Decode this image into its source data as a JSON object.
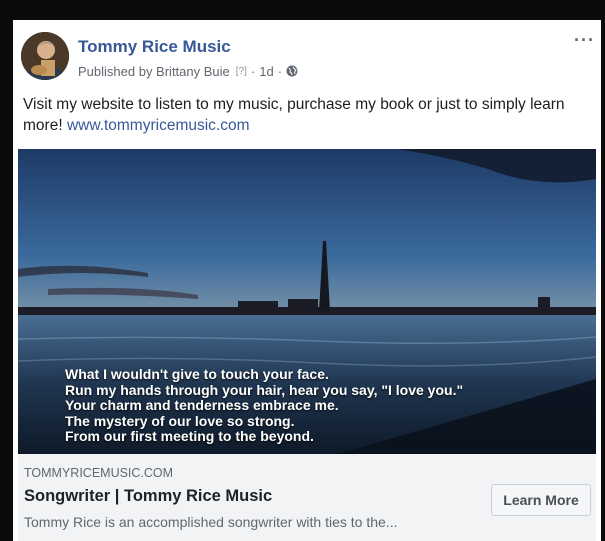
{
  "post": {
    "page_name": "Tommy Rice Music",
    "published_by": "Published by Brittany Buie",
    "help_marker": "[?]",
    "separator": "·",
    "time": "1d",
    "more_label": "···",
    "text_before_link": "Visit my website to listen to my music, purchase my book or just to simply learn more! ",
    "link_text": "www.tommyricemusic.com"
  },
  "image": {
    "poem_lines": [
      "What I wouldn't give to touch your face.",
      "Run my hands through your hair, hear you say, \"I love you.\"",
      "Your charm and tenderness embrace me.",
      "The mystery of our love so strong.",
      "From our first meeting to the beyond."
    ]
  },
  "link_preview": {
    "domain": "TOMMYRICEMUSIC.COM",
    "title": "Songwriter | Tommy Rice Music",
    "description": "Tommy Rice is an accomplished songwriter with ties to the...",
    "cta_label": "Learn More"
  },
  "icons": [
    "avatar",
    "globe-icon",
    "more-options-icon"
  ],
  "colors": {
    "link": "#385898",
    "meta": "#606770",
    "preview_bg": "#f2f3f5"
  }
}
